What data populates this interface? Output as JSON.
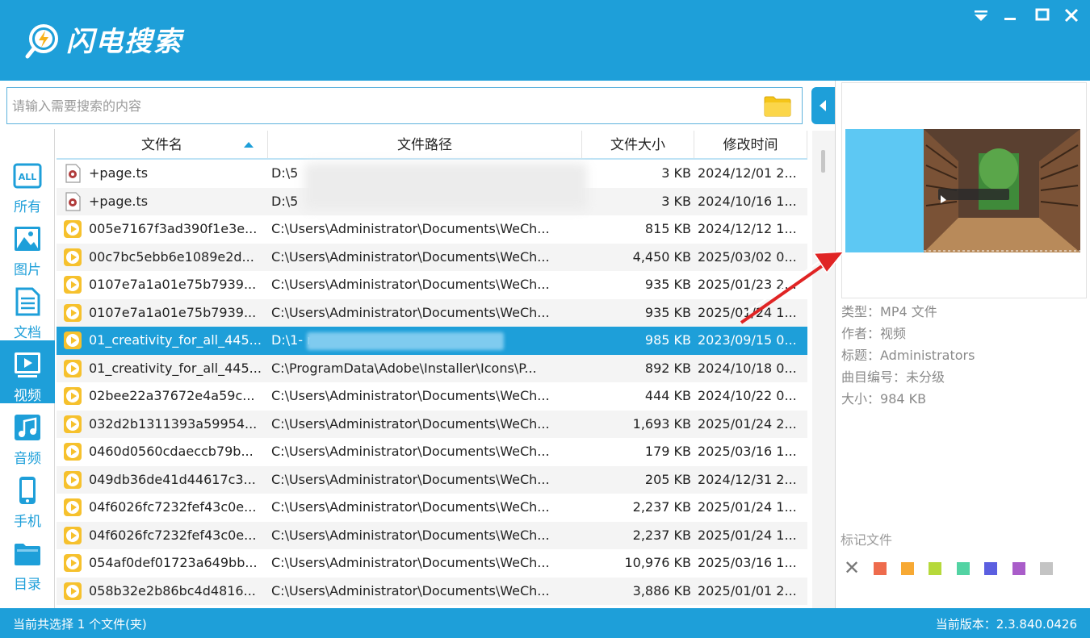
{
  "app": {
    "title": "闪电搜索"
  },
  "window_controls": [
    "menu",
    "minimize",
    "maximize",
    "close"
  ],
  "search": {
    "placeholder": "请输入需要搜索的内容",
    "value": ""
  },
  "sidebar": {
    "items": [
      {
        "label": "所有",
        "icon": "all-icon",
        "active": false
      },
      {
        "label": "图片",
        "icon": "picture-icon",
        "active": false
      },
      {
        "label": "文档",
        "icon": "document-icon",
        "active": false
      },
      {
        "label": "视频",
        "icon": "video-icon",
        "active": true
      },
      {
        "label": "音频",
        "icon": "audio-icon",
        "active": false
      },
      {
        "label": "手机",
        "icon": "phone-icon",
        "active": false
      },
      {
        "label": "目录",
        "icon": "folder-icon",
        "active": false
      }
    ]
  },
  "table": {
    "headers": {
      "name": "文件名",
      "path": "文件路径",
      "size": "文件大小",
      "time": "修改时间"
    },
    "sort": "name-ascending",
    "rows": [
      {
        "name": "+page.ts",
        "path": "D:\\5",
        "size": "3 KB",
        "time": "2024/12/01 2...",
        "type": "ts",
        "selected": false
      },
      {
        "name": "+page.ts",
        "path": "D:\\5",
        "size": "3 KB",
        "time": "2024/10/16 1...",
        "type": "ts",
        "selected": false
      },
      {
        "name": "005e7167f3ad390f1e3e...",
        "path": "C:\\Users\\Administrator\\Documents\\WeCh...",
        "size": "815 KB",
        "time": "2024/12/12 1...",
        "type": "video",
        "selected": false
      },
      {
        "name": "00c7bc5ebb6e1089e2d...",
        "path": "C:\\Users\\Administrator\\Documents\\WeCh...",
        "size": "4,450 KB",
        "time": "2025/03/02 0...",
        "type": "video",
        "selected": false
      },
      {
        "name": "0107e7a1a01e75b7939...",
        "path": "C:\\Users\\Administrator\\Documents\\WeCh...",
        "size": "935 KB",
        "time": "2025/01/23 2...",
        "type": "video",
        "selected": false
      },
      {
        "name": "0107e7a1a01e75b7939...",
        "path": "C:\\Users\\Administrator\\Documents\\WeCh...",
        "size": "935 KB",
        "time": "2025/01/24 1...",
        "type": "video",
        "selected": false
      },
      {
        "name": "01_creativity_for_all_445...",
        "path": "D:\\1-                                         resource...",
        "size": "985 KB",
        "time": "2023/09/15 0...",
        "type": "video",
        "selected": true
      },
      {
        "name": "01_creativity_for_all_445...",
        "path": "C:\\ProgramData\\Adobe\\Installer\\Icons\\P...",
        "size": "892 KB",
        "time": "2024/10/18 0...",
        "type": "video",
        "selected": false
      },
      {
        "name": "02bee22a37672e4a59c...",
        "path": "C:\\Users\\Administrator\\Documents\\WeCh...",
        "size": "444 KB",
        "time": "2024/10/22 0...",
        "type": "video",
        "selected": false
      },
      {
        "name": "032d2b1311393a59954...",
        "path": "C:\\Users\\Administrator\\Documents\\WeCh...",
        "size": "1,693 KB",
        "time": "2025/01/24 2...",
        "type": "video",
        "selected": false
      },
      {
        "name": "0460d0560cdaeccb79b...",
        "path": "C:\\Users\\Administrator\\Documents\\WeCh...",
        "size": "179 KB",
        "time": "2025/03/16 1...",
        "type": "video",
        "selected": false
      },
      {
        "name": "049db36de41d44617c3...",
        "path": "C:\\Users\\Administrator\\Documents\\WeCh...",
        "size": "205 KB",
        "time": "2024/12/31 2...",
        "type": "video",
        "selected": false
      },
      {
        "name": "04f6026fc7232fef43c0e...",
        "path": "C:\\Users\\Administrator\\Documents\\WeCh...",
        "size": "2,237 KB",
        "time": "2025/01/24 1...",
        "type": "video",
        "selected": false
      },
      {
        "name": "04f6026fc7232fef43c0e...",
        "path": "C:\\Users\\Administrator\\Documents\\WeCh...",
        "size": "2,237 KB",
        "time": "2025/01/24 1...",
        "type": "video",
        "selected": false
      },
      {
        "name": "054af0def01723a649bb...",
        "path": "C:\\Users\\Administrator\\Documents\\WeCh...",
        "size": "10,976 KB",
        "time": "2025/03/16 1...",
        "type": "video",
        "selected": false
      },
      {
        "name": "058b32e2b86bc4d4816...",
        "path": "C:\\Users\\Administrator\\Documents\\WeCh...",
        "size": "3,886 KB",
        "time": "2025/01/01 2...",
        "type": "video",
        "selected": false
      }
    ]
  },
  "preview": {
    "meta": [
      {
        "key": "类型：",
        "value": "MP4 文件"
      },
      {
        "key": "作者：",
        "value": "视频"
      },
      {
        "key": "标题：",
        "value": "Administrators"
      },
      {
        "key": "曲目编号：",
        "value": "未分级"
      },
      {
        "key": "大小：",
        "value": "984 KB"
      }
    ],
    "mark_title": "标记文件",
    "mark_colors": [
      "#ee6b4d",
      "#f7a934",
      "#b6d93b",
      "#53d3a3",
      "#5b5fe0",
      "#a95dc9",
      "#c4c4c4"
    ]
  },
  "status": {
    "left": "当前共选择 1 个文件(夹)",
    "right": "当前版本：2.3.840.0426"
  },
  "colors": {
    "accent": "#1e9fd9",
    "selected_row": "#1e9fd9",
    "video_icon": "#f6c12d",
    "annotation": "#e02424"
  }
}
